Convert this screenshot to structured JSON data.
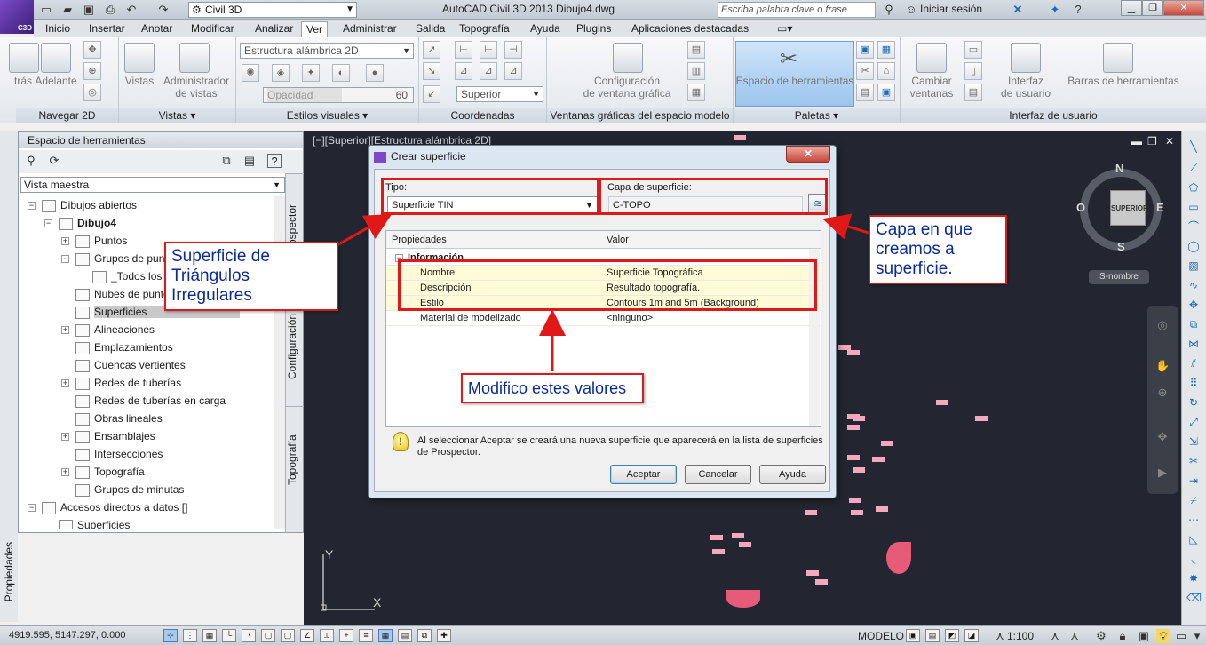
{
  "titlebar": {
    "logo": "C3D",
    "workspace": "Civil 3D",
    "title": "AutoCAD Civil 3D 2013   Dibujo4.dwg",
    "search_placeholder": "Escriba palabra clave o frase",
    "signin": "Iniciar sesión"
  },
  "ribbon_tabs": [
    "Inicio",
    "Insertar",
    "Anotar",
    "Modificar",
    "Analizar",
    "Ver",
    "Administrar",
    "Salida",
    "Topografía",
    "Ayuda",
    "Plugins",
    "Aplicaciones destacadas"
  ],
  "active_tab": "Ver",
  "ribbon": {
    "navegar": {
      "title": "Navegar 2D",
      "atras": "trás",
      "adelante": "Adelante"
    },
    "vistas": {
      "title": "Vistas",
      "vistas_label": "Vistas",
      "admin_label_1": "Administrador",
      "admin_label_2": "de vistas"
    },
    "estilos": {
      "title": "Estilos visuales",
      "combo": "Estructura alámbrica 2D",
      "opacidad": "Opacidad",
      "opacidad_val": "60"
    },
    "coordenadas": {
      "title": "Coordenadas",
      "combo": "Superior"
    },
    "ventanas": {
      "title": "Ventanas gráficas del espacio modelo",
      "config_1": "Configuración",
      "config_2": "de ventana gráfica"
    },
    "paletas": {
      "title": "Paletas",
      "espacio": "Espacio de herramientas"
    },
    "interfaz": {
      "title": "Interfaz de usuario",
      "cambiar_1": "Cambiar",
      "cambiar_2": "ventanas",
      "interfaz_1": "Interfaz",
      "interfaz_2": "de usuario",
      "barras": "Barras de herramientas"
    }
  },
  "toolspace": {
    "title": "Espacio de herramientas",
    "view": "Vista maestra",
    "tree": [
      {
        "label": "Dibujos abiertos",
        "level": 0,
        "exp": "−"
      },
      {
        "label": "Dibujo4",
        "level": 1,
        "exp": "−",
        "bold": true
      },
      {
        "label": "Puntos",
        "level": 2,
        "exp": "+"
      },
      {
        "label": "Grupos de puntos",
        "level": 2,
        "exp": "−"
      },
      {
        "label": "_Todos los",
        "level": 3,
        "exp": ""
      },
      {
        "label": "Nubes de puntos",
        "level": 2,
        "exp": ""
      },
      {
        "label": "Superficies",
        "level": 2,
        "exp": "",
        "selected": true
      },
      {
        "label": "Alineaciones",
        "level": 2,
        "exp": "+"
      },
      {
        "label": "Emplazamientos",
        "level": 2,
        "exp": ""
      },
      {
        "label": "Cuencas vertientes",
        "level": 2,
        "exp": ""
      },
      {
        "label": "Redes de tuberías",
        "level": 2,
        "exp": "+"
      },
      {
        "label": "Redes de tuberías en carga",
        "level": 2,
        "exp": ""
      },
      {
        "label": "Obras lineales",
        "level": 2,
        "exp": ""
      },
      {
        "label": "Ensamblajes",
        "level": 2,
        "exp": "+"
      },
      {
        "label": "Intersecciones",
        "level": 2,
        "exp": ""
      },
      {
        "label": "Topografía",
        "level": 2,
        "exp": "+"
      },
      {
        "label": "Grupos de minutas",
        "level": 2,
        "exp": ""
      },
      {
        "label": "Accesos directos a datos []",
        "level": 0,
        "exp": "−"
      },
      {
        "label": "Superficies",
        "level": 1,
        "exp": ""
      }
    ],
    "vtabs": [
      "Prospector",
      "Configuración",
      "Topografía"
    ],
    "properties_tab": "Propiedades"
  },
  "drawing": {
    "viewport_label": "[−][Superior][Estructura alámbrica 2D]",
    "compass": {
      "n": "N",
      "s": "S",
      "e": "E",
      "o": "O"
    },
    "cube_face": "SUPERIOR",
    "wcs": "S-nombre",
    "ucs_y": "Y",
    "ucs_x": "X"
  },
  "dialog": {
    "title": "Crear superficie",
    "tipo_label": "Tipo:",
    "tipo_value": "Superficie TIN",
    "capa_label": "Capa de superficie:",
    "capa_value": "C-TOPO",
    "grid_headers": {
      "prop": "Propiedades",
      "val": "Valor"
    },
    "section": "Información",
    "rows": [
      {
        "prop": "Nombre",
        "val": "Superficie Topográfica"
      },
      {
        "prop": "Descripción",
        "val": "Resultado topografía."
      },
      {
        "prop": "Estilo",
        "val": "Contours 1m and 5m (Background)"
      },
      {
        "prop": "Material de modelizado",
        "val": "<ninguno>"
      }
    ],
    "info": "Al seleccionar Aceptar se creará una nueva superficie que aparecerá en la lista de superficies de Prospector.",
    "buttons": {
      "ok": "Aceptar",
      "cancel": "Cancelar",
      "help": "Ayuda"
    }
  },
  "annotations": {
    "tipo_callout": "Superficie de Triángulos Irregulares",
    "capa_callout": "Capa en que creamos a superficie.",
    "valores_callout": "Modifico estes valores"
  },
  "statusbar": {
    "coords": "4919.595, 5147.297, 0.000",
    "modelo": "MODELO",
    "scale": "1:100"
  }
}
